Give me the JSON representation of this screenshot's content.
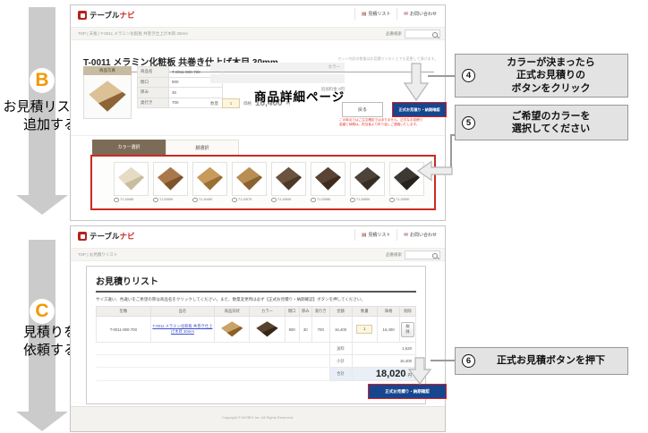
{
  "colors": {
    "brand_red": "#b5211d",
    "button_blue": "#17468f",
    "button_border_red": "#e01b1b",
    "swatch_highlight_red": "#cc2a22",
    "step_letter_orange": "#f39800",
    "callout_bg": "#e3e3e3",
    "total_row_bg": "#e9eff6"
  },
  "flow": {
    "b": {
      "letter": "B",
      "line1": "お見積リストに",
      "line2": "追加する"
    },
    "c": {
      "letter": "C",
      "line1": "見積りを",
      "line2": "依頼する"
    }
  },
  "callouts": {
    "c4": {
      "num": "4",
      "line1": "カラーが決まったら",
      "line2": "正式お見積りの",
      "line3": "ボタンをクリック"
    },
    "c5": {
      "num": "5",
      "line1": "ご希望のカラーを",
      "line2": "選択してください"
    },
    "c6": {
      "num": "6",
      "line1": "正式お見積ボタンを押下"
    }
  },
  "site": {
    "logo_text": "テーブル",
    "logo_accent": "ナビ",
    "nav_quote": "見積リスト",
    "nav_contact": "お問い合わせ",
    "search_label": "品番検索"
  },
  "page_a": {
    "overlay_label": "商品詳細ページ",
    "breadcrumb": "TOP | 天板 | T-0011 メラミン化粧板 共巻き仕上げ木目 30mm",
    "title": "T-0011 メラミン化粧板 共巻き仕上げ木目 30mm",
    "photo_label": "商品写真",
    "photo_wood": {
      "top": "#dcc096",
      "side": "#8d6436"
    },
    "specs": [
      {
        "label": "商品名",
        "value": "T-0011-900-700"
      },
      {
        "label": "間口",
        "value": "900"
      },
      {
        "label": "厚み",
        "value": "30"
      },
      {
        "label": "奥行き",
        "value": "700"
      }
    ],
    "note": "セット内訳の数量はお見積りリスト上でも変更して頂けます。",
    "color_row_label": "カラー",
    "addon_label": "追加料金",
    "addon_price": "0円",
    "qty_label": "数量",
    "qty_value": "1",
    "price_label": "価格",
    "price_value": "16,400",
    "price_unit": "円",
    "back_button": "戻る",
    "quote_button": "正式お見積り・納期確認",
    "red_note_line1": "この時点ではご注文確定ではありません。正式なお見積り",
    "red_note_line2": "金額と納期は、担当者より折り返しご連絡いたします。",
    "tabs": [
      {
        "label": "カラー選択"
      },
      {
        "label": "脚選択"
      }
    ],
    "swatches": [
      {
        "code": "TJ-1008K",
        "top": "#e6dcc6",
        "side": "#c9bda0"
      },
      {
        "code": "TJ-2055K",
        "top": "#a8784a",
        "side": "#7d5329"
      },
      {
        "code": "TJ-1040K",
        "top": "#c89a5c",
        "side": "#9a6f33"
      },
      {
        "code": "TJ-1057K",
        "top": "#b98e52",
        "side": "#8a6230"
      },
      {
        "code": "TJ-1060K",
        "top": "#6b5340",
        "side": "#4c3826"
      },
      {
        "code": "TJ-2058K",
        "top": "#5a4332",
        "side": "#3d2c1e"
      },
      {
        "code": "TJ-2085K",
        "top": "#4e4338",
        "side": "#352c23"
      },
      {
        "code": "TJ-1059K",
        "top": "#3e3833",
        "side": "#27221e"
      }
    ]
  },
  "page_c": {
    "breadcrumb": "TOP | お見積りリスト",
    "title": "お見積りリスト",
    "description": "サイズ違い、色違いをご希望の際は商品名をクリックしてください。また、数量変更時は必ず【正式お見積り・納期確認】ボタンを押してください。",
    "shape_wood": {
      "top": "#c9a468",
      "side": "#8c6026"
    },
    "color_wood": {
      "top": "#57422f",
      "side": "#352616"
    },
    "table": {
      "headers": [
        "型番",
        "品名",
        "商品形状",
        "カラー",
        "間口",
        "厚み",
        "奥行き",
        "金額",
        "数量",
        "価格",
        "削除"
      ],
      "row": {
        "model": "T-0011-900-700",
        "name": "T-0011 メラミン化粧板 共巻き仕上げ木目 30mm",
        "width": "900",
        "thickness": "30",
        "depth": "700",
        "amount": "16,400",
        "qty": "1",
        "price": "16,400",
        "delete_label": "削除"
      },
      "shipping_label": "送料",
      "shipping_value": "1,620",
      "subtotal_label": "小計",
      "subtotal_value": "16,400",
      "total_label": "合計",
      "total_value": "18,020",
      "total_unit": "円"
    },
    "quote_button": "正式お見積り・納期確認",
    "footer": "Copyright © MOBIO,Inc. All Rights Reserved."
  }
}
